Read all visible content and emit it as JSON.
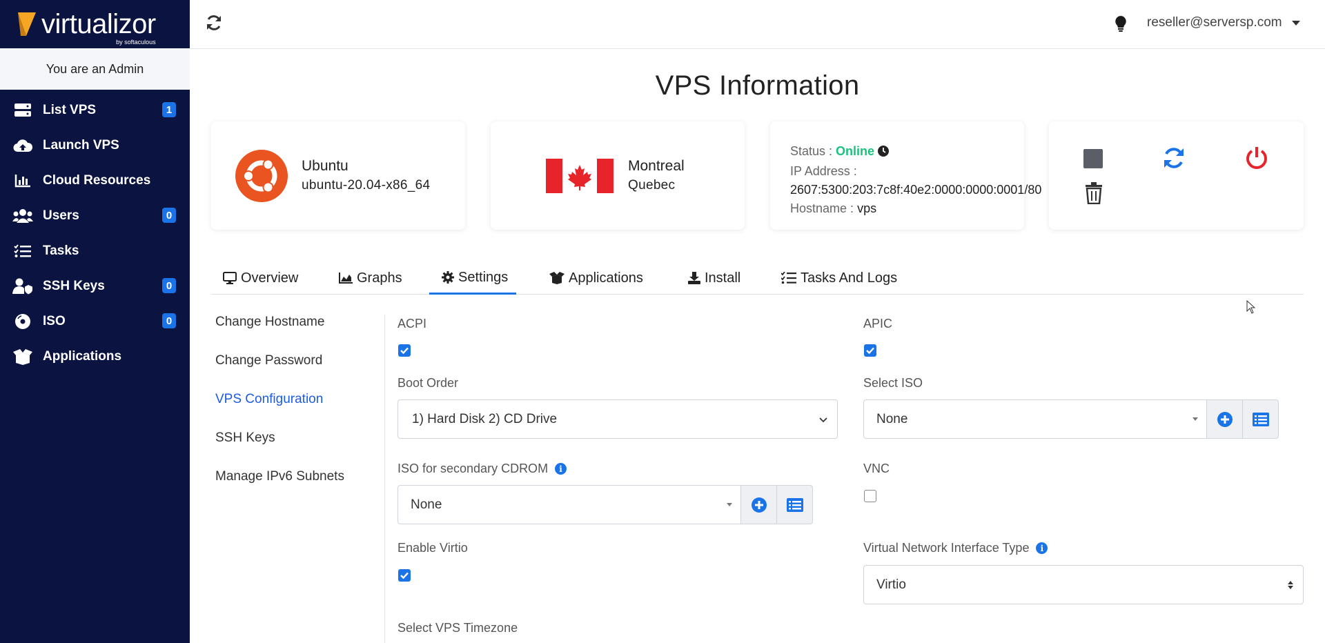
{
  "brand": {
    "name": "virtualizor",
    "sub": "by softaculous"
  },
  "sidebar": {
    "admin_text": "You are an Admin",
    "items": [
      {
        "label": "List VPS",
        "icon": "server-icon",
        "badge": "1"
      },
      {
        "label": "Launch VPS",
        "icon": "cloud-upload-icon",
        "badge": ""
      },
      {
        "label": "Cloud Resources",
        "icon": "bar-chart-icon",
        "badge": ""
      },
      {
        "label": "Users",
        "icon": "users-icon",
        "badge": "0"
      },
      {
        "label": "Tasks",
        "icon": "tasks-list-icon",
        "badge": ""
      },
      {
        "label": "SSH Keys",
        "icon": "user-shield-icon",
        "badge": "0"
      },
      {
        "label": "ISO",
        "icon": "disc-icon",
        "badge": "0"
      },
      {
        "label": "Applications",
        "icon": "box-open-icon",
        "badge": ""
      }
    ]
  },
  "header": {
    "user": "reseller@serversp.com"
  },
  "page": {
    "title": "VPS Information"
  },
  "cards": {
    "os": {
      "name": "Ubuntu",
      "version": "ubuntu-20.04-x86_64"
    },
    "location": {
      "city": "Montreal",
      "region": "Quebec"
    },
    "info": {
      "status_label": "Status :",
      "status_value": "Online",
      "ip_label": "IP Address :",
      "ip_value": "2607:5300:203:7c8f:40e2:0000:0000:0001/80",
      "hostname_label": "Hostname :",
      "hostname_value": "vps"
    }
  },
  "tabs": [
    {
      "label": "Overview",
      "icon": "desktop-icon"
    },
    {
      "label": "Graphs",
      "icon": "area-chart-icon"
    },
    {
      "label": "Settings",
      "icon": "gear-icon",
      "active": true
    },
    {
      "label": "Applications",
      "icon": "box-open-icon"
    },
    {
      "label": "Install",
      "icon": "download-icon"
    },
    {
      "label": "Tasks And Logs",
      "icon": "tasks-list-icon"
    }
  ],
  "settings_menu": [
    {
      "label": "Change Hostname"
    },
    {
      "label": "Change Password"
    },
    {
      "label": "VPS Configuration",
      "active": true
    },
    {
      "label": "SSH Keys"
    },
    {
      "label": "Manage IPv6 Subnets"
    }
  ],
  "form": {
    "acpi": {
      "label": "ACPI",
      "checked": true
    },
    "apic": {
      "label": "APIC",
      "checked": true
    },
    "boot_order": {
      "label": "Boot Order",
      "value": "1) Hard Disk 2) CD Drive"
    },
    "select_iso": {
      "label": "Select ISO",
      "value": "None"
    },
    "secondary_iso": {
      "label": "ISO for secondary CDROM",
      "value": "None"
    },
    "vnc": {
      "label": "VNC",
      "checked": false
    },
    "virtio": {
      "label": "Enable Virtio",
      "checked": true
    },
    "nic_type": {
      "label": "Virtual Network Interface Type",
      "value": "Virtio"
    },
    "timezone": {
      "label": "Select VPS Timezone"
    }
  },
  "colors": {
    "sidebar_bg": "#0b1340",
    "accent": "#1a74e8",
    "online": "#19c37d",
    "power": "#e8242b",
    "ubuntu": "#e95420"
  }
}
